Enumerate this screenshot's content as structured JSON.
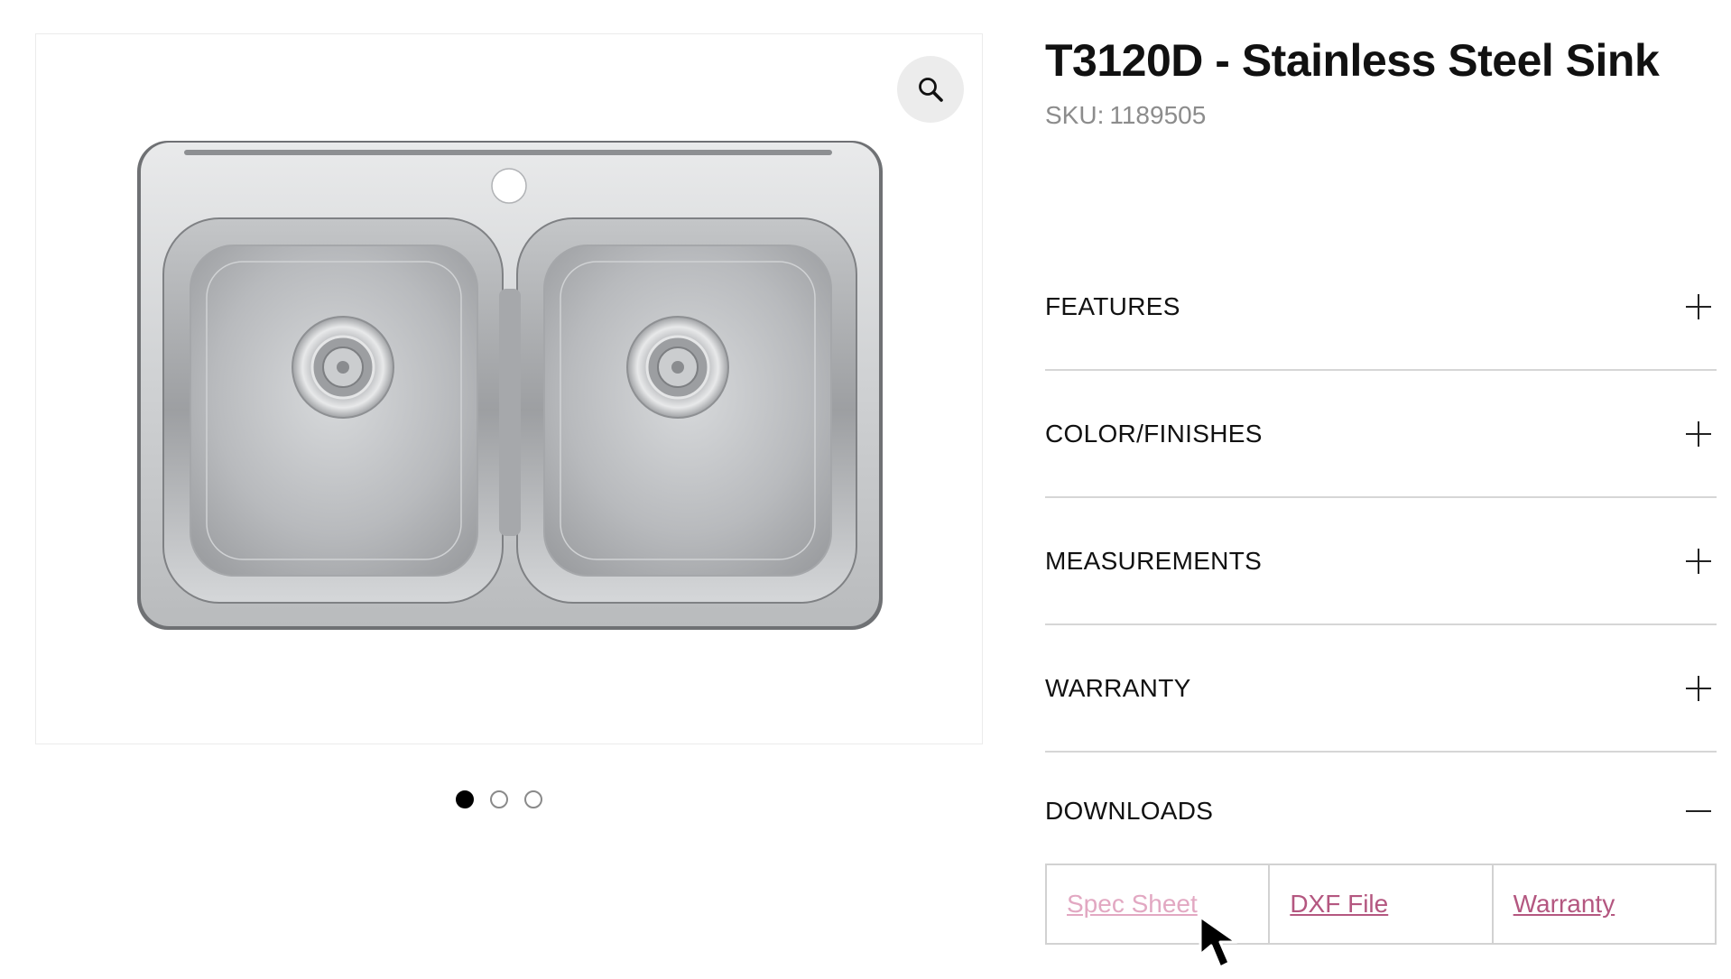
{
  "product": {
    "title": "T3120D - Stainless Steel Sink",
    "sku_label": "SKU:",
    "sku_value": "1189505"
  },
  "gallery": {
    "zoom_icon": "magnifier-icon",
    "image_alt": "Double bowl stainless steel sink",
    "slides": 3,
    "active_slide": 1
  },
  "accordion": [
    {
      "label": "FEATURES",
      "icon": "plus-icon",
      "expanded": false
    },
    {
      "label": "COLOR/FINISHES",
      "icon": "plus-icon",
      "expanded": false
    },
    {
      "label": "MEASUREMENTS",
      "icon": "plus-icon",
      "expanded": false
    },
    {
      "label": "WARRANTY",
      "icon": "plus-icon",
      "expanded": false
    },
    {
      "label": "DOWNLOADS",
      "icon": "minus-icon",
      "expanded": true
    }
  ],
  "downloads": {
    "links": [
      "Spec Sheet",
      "DXF File",
      "Warranty"
    ]
  },
  "colors": {
    "link": "#b45780",
    "link_hover": "#e2a8c2",
    "divider": "#d6d6d6",
    "sku": "#8c8c8c"
  }
}
